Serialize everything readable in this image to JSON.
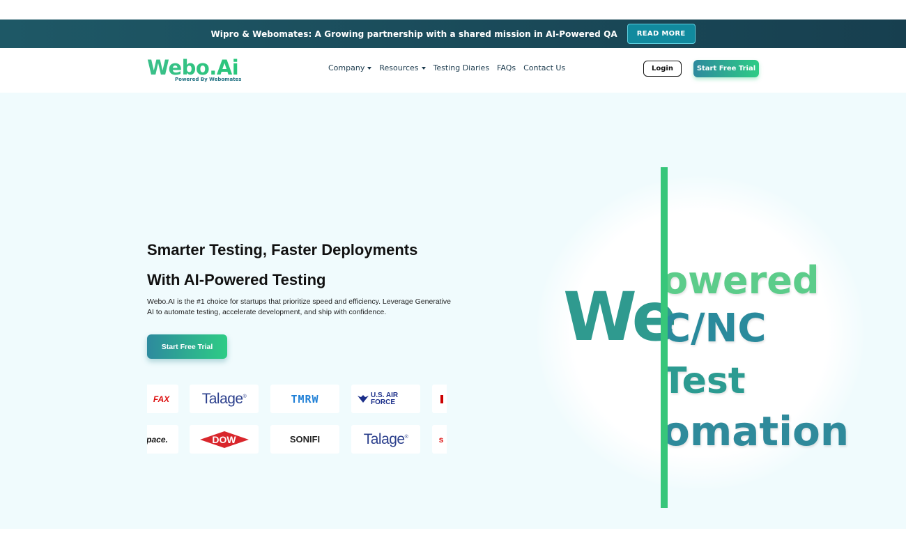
{
  "announcement": {
    "message": "Wipro & Webomates: A Growing partnership with a shared mission in AI-Powered QA",
    "cta_label": "READ MORE"
  },
  "nav": {
    "logo_text": "Webo.Ai",
    "logo_sub": "Powered By Webomates",
    "links": {
      "company": "Company",
      "resources": "Resources",
      "testing_diaries": "Testing Diaries",
      "faqs": "FAQs",
      "contact": "Contact Us"
    },
    "login_label": "Login",
    "trial_label": "Start Free Trial"
  },
  "hero": {
    "headline_line1": "Smarter Testing, Faster Deployments",
    "headline_line2": "With AI-Powered Testing",
    "subtext": "Webo.AI is the #1 choice for startups that prioritize speed and efficiency. Leverage Generative AI to automate testing, accelerate development, and ship with confidence.",
    "cta_label": "Start Free Trial"
  },
  "client_logos": {
    "row1": [
      "FAX",
      "Talage",
      "TMRW",
      "U.S. AIR FORCE"
    ],
    "row2": [
      "pace.",
      "DOW",
      "SONIFI",
      "Talage"
    ]
  },
  "animated_panel": {
    "big_letters": "We",
    "words": [
      "owered",
      "C/NC",
      "Test",
      "omation"
    ]
  },
  "colors": {
    "accent_green": "#2ecc85",
    "accent_teal": "#2d8a9e",
    "announce_bg": "#1e5866",
    "hero_bg": "#f0fbfd"
  }
}
